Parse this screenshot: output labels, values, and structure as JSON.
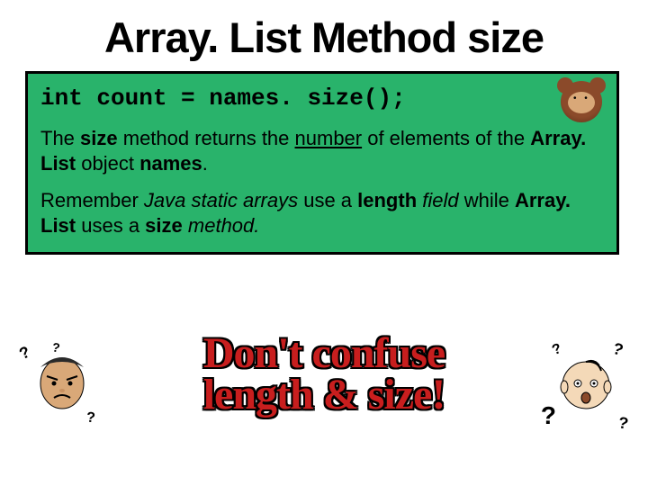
{
  "title": "Array. List Method size",
  "code_line": "int count = names. size();",
  "para1": {
    "t1": "The ",
    "b1": "size",
    "t2": " method returns the ",
    "u1": "number",
    "t3": " of elements of the ",
    "b2": "Array. List",
    "t4": " object ",
    "b3": "names",
    "t5": "."
  },
  "para2": {
    "t1": "Remember ",
    "i1": "Java static arrays",
    "t2": " use a ",
    "b1": "length",
    "t3": " ",
    "i2": "field",
    "t4": " while ",
    "b2": "Array. List",
    "t5": " uses a ",
    "b3": "size",
    "t6": " ",
    "i3": "method.",
    "t7": ""
  },
  "warning_line1": "Don't confuse",
  "warning_line2": "length & size!",
  "icons": {
    "monkey": "monkey-icon",
    "angry": "angry-face-icon",
    "confused": "confused-face-icon"
  },
  "qmarks": {
    "q1": "?",
    "q2": "?",
    "q3": "?",
    "q4": "?",
    "q5": "?",
    "q6": "?",
    "q7": "?"
  }
}
